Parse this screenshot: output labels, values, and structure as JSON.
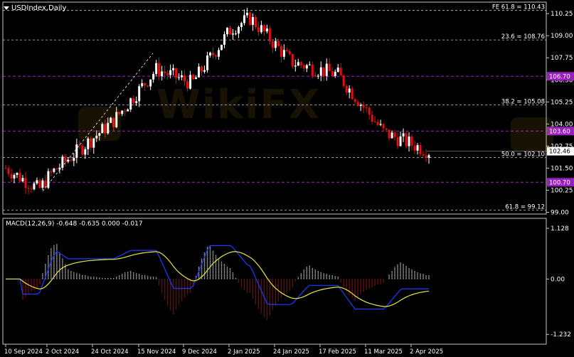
{
  "chart": {
    "symbol": "USDIndex,Daily",
    "watermark": "WikiFX",
    "price_scale": [
      "110.25",
      "109.00",
      "107.75",
      "106.50",
      "105.25",
      "104.00",
      "102.75",
      "101.50",
      "100.25",
      "99.00"
    ],
    "fib_levels": [
      {
        "label": "FE 61.8 = 110.43",
        "value": 110.43
      },
      {
        "label": "23.6 = 108.76",
        "value": 108.76
      },
      {
        "label": "38.2 = 105.08",
        "value": 105.08
      },
      {
        "label": "50.0 = 102.10",
        "value": 102.1
      },
      {
        "label": "61.8 = 99.12",
        "value": 99.12
      }
    ],
    "hlines": [
      {
        "label": "106.70",
        "value": 106.7
      },
      {
        "label": "103.60",
        "value": 103.6
      },
      {
        "label": "100.70",
        "value": 100.7
      }
    ],
    "current_price": "102.46",
    "date_labels": [
      "10 Sep 2024",
      "2 Oct 2024",
      "24 Oct 2024",
      "15 Nov 2024",
      "9 Dec 2024",
      "2 Jan 2025",
      "24 Jan 2025",
      "17 Feb 2025",
      "11 Mar 2025",
      "2 Apr 2025"
    ],
    "macd": {
      "label": "MACD(12,26,9) -0.648 -0.635 0.000 -0.017",
      "scale": [
        "1.128",
        "0.00",
        "-1.232"
      ]
    },
    "colors": {
      "bull": "#ffffff",
      "bear": "#e01010",
      "macd_line": "#1e3cff",
      "signal_line": "#e8e840",
      "level": "#a020c0",
      "fib": "#c8c8c8"
    }
  },
  "chart_data": {
    "type": "candlestick",
    "title": "USDIndex,Daily",
    "x_range": [
      "10 Sep 2024",
      "2 Apr 2025"
    ],
    "ylim": [
      99.0,
      110.8
    ],
    "anchors": [
      {
        "date": "10 Sep 2024",
        "close": 101.5
      },
      {
        "date": "27 Sep 2024",
        "close": 100.3
      },
      {
        "date": "2 Oct 2024",
        "close": 101.2
      },
      {
        "date": "24 Oct 2024",
        "close": 104.2
      },
      {
        "date": "15 Nov 2024",
        "close": 107.1
      },
      {
        "date": "9 Dec 2024",
        "close": 106.3
      },
      {
        "date": "2 Jan 2025",
        "close": 109.4
      },
      {
        "date": "13 Jan 2025",
        "close": 110.0
      },
      {
        "date": "24 Jan 2025",
        "close": 107.5
      },
      {
        "date": "17 Feb 2025",
        "close": 106.8
      },
      {
        "date": "11 Mar 2025",
        "close": 103.5
      },
      {
        "date": "2 Apr 2025",
        "close": 102.46
      }
    ],
    "macd_range": [
      -1.232,
      1.128
    ]
  }
}
